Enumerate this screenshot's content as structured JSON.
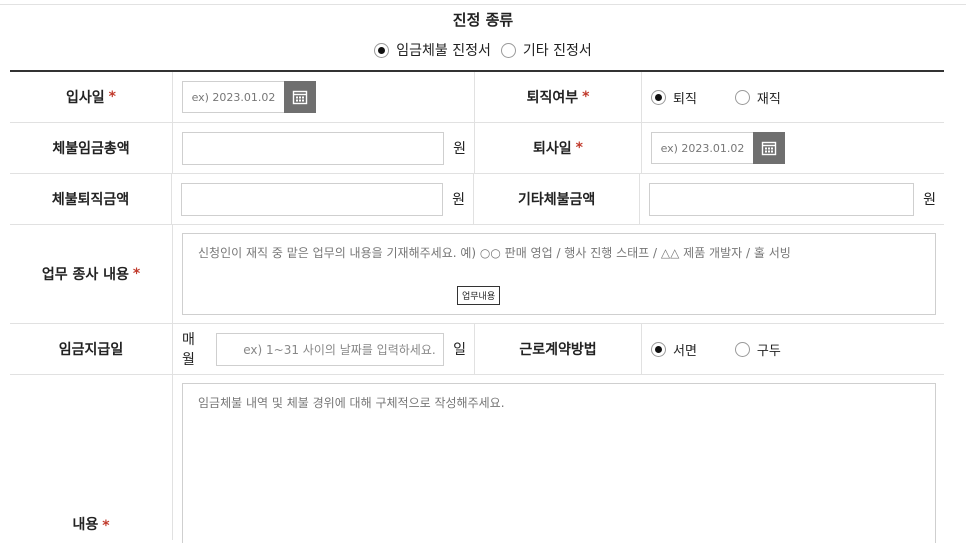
{
  "section": {
    "title": "진정 종류",
    "options": [
      {
        "label": "임금체불 진정서",
        "selected": true
      },
      {
        "label": "기타 진정서",
        "selected": false
      }
    ]
  },
  "required_mark": "*",
  "form": {
    "hire_date": {
      "label": "입사일",
      "placeholder": "ex) 2023.01.02"
    },
    "retired": {
      "label": "퇴직여부",
      "options": [
        {
          "label": "퇴직",
          "selected": true
        },
        {
          "label": "재직",
          "selected": false
        }
      ]
    },
    "unpaid_total": {
      "label": "체불임금총액",
      "unit": "원"
    },
    "leave_date": {
      "label": "퇴사일",
      "placeholder": "ex) 2023.01.02"
    },
    "unpaid_severance": {
      "label": "체불퇴직금액",
      "unit": "원"
    },
    "other_unpaid": {
      "label": "기타체불금액",
      "unit": "원"
    },
    "duty": {
      "label": "업무 종사 내용",
      "placeholder": "신청인이 재직 중 맡은 업무의 내용을 기재해주세요. 예) ○○ 판매 영업 / 행사 진행 스태프 / △△ 제품 개발자 / 홀 서빙",
      "button": "업무내용"
    },
    "pay_day": {
      "label": "임금지급일",
      "prefix": "매월",
      "placeholder": "ex) 1~31 사이의 날짜를 입력하세요.",
      "unit": "일"
    },
    "contract": {
      "label": "근로계약방법",
      "options": [
        {
          "label": "서면",
          "selected": true
        },
        {
          "label": "구두",
          "selected": false
        }
      ]
    },
    "content": {
      "label": "내용",
      "placeholder": "임금체불 내역 및 체불 경위에 대해 구체적으로 작성해주세요."
    }
  }
}
